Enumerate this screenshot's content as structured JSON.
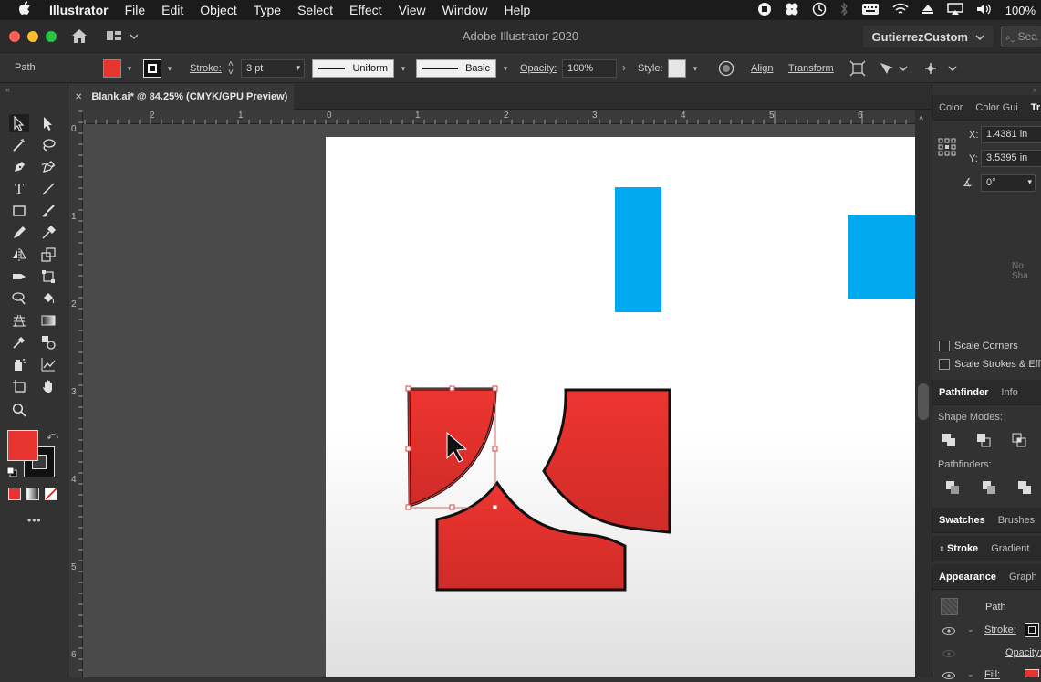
{
  "menubar": {
    "apple": "",
    "app_name": "Illustrator",
    "items": [
      "File",
      "Edit",
      "Object",
      "Type",
      "Select",
      "Effect",
      "View",
      "Window",
      "Help"
    ],
    "battery": "100%"
  },
  "titlebar": {
    "title": "Adobe Illustrator 2020",
    "workspace": "GutierrezCustom",
    "search_placeholder": "Sea"
  },
  "controlbar": {
    "selection_type": "Path",
    "fill_color": "#e8342e",
    "stroke_label": "Stroke:",
    "stroke_weight": "3 pt",
    "variable_width": "Uniform",
    "brush": "Basic",
    "opacity_label": "Opacity:",
    "opacity": "100%",
    "style_label": "Style:",
    "align_label": "Align",
    "transform_label": "Transform"
  },
  "document": {
    "tab_title": "Blank.ai* @ 84.25% (CMYK/GPU Preview)",
    "close_glyph": "✕"
  },
  "rulers": {
    "top": [
      "2",
      "1",
      "0",
      "1",
      "2",
      "3",
      "4",
      "5",
      "6"
    ],
    "left": [
      "0",
      "1",
      "2",
      "3",
      "4",
      "5",
      "6"
    ]
  },
  "colors": {
    "red_fill": "#e8342e",
    "blue": "#03a9ee",
    "selection": "#e0413e"
  },
  "toolpanel": {
    "fill_color": "#e8342e",
    "more": "•••"
  },
  "transform_panel": {
    "tabs": [
      "Color",
      "Color Gui",
      "Tr"
    ],
    "x_label": "X:",
    "x_value": "1.4381 in",
    "y_label": "Y:",
    "y_value": "3.5395 in",
    "angle_value": "0°",
    "no_shape": "No Sha",
    "scale_corners": "Scale Corners",
    "scale_strokes": "Scale Strokes & Effe"
  },
  "pathfinder_panel": {
    "tabs": [
      "Pathfinder",
      "Info"
    ],
    "shape_modes": "Shape Modes:",
    "pathfinders": "Pathfinders:"
  },
  "panel_groups": {
    "swatches": [
      "Swatches",
      "Brushes"
    ],
    "stroke": [
      "Stroke",
      "Gradient"
    ]
  },
  "appearance_panel": {
    "tabs": [
      "Appearance",
      "Graph"
    ],
    "object": "Path",
    "stroke_label": "Stroke:",
    "opacity_label": "Opacity:",
    "fill_label": "Fill:"
  }
}
